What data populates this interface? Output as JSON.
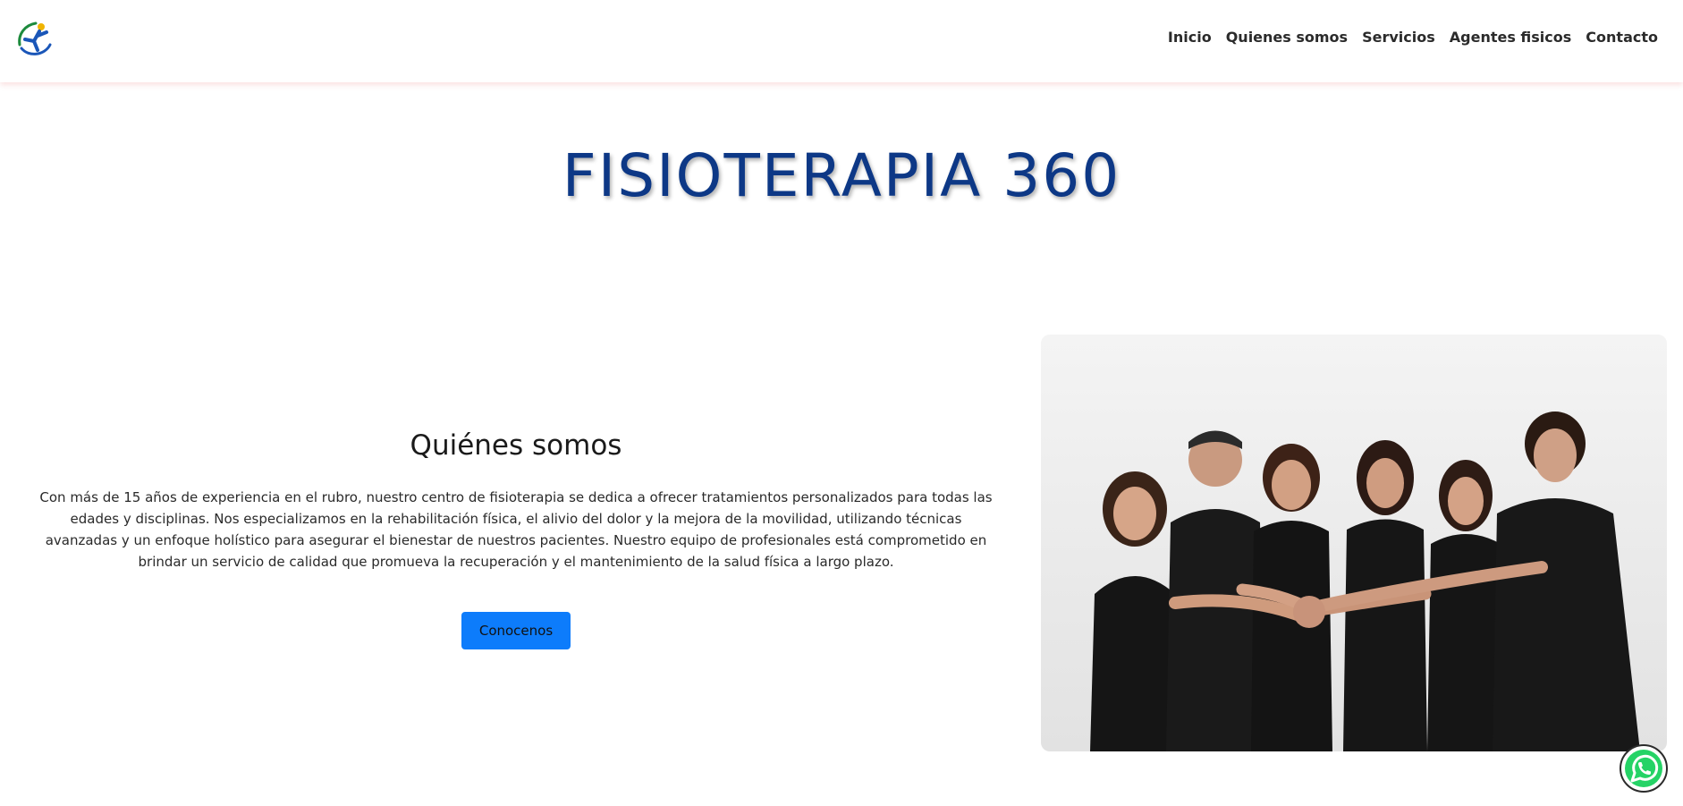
{
  "header": {
    "logo_icon": "physio-runner-logo-icon",
    "nav": [
      {
        "label": "Inicio"
      },
      {
        "label": "Quienes somos"
      },
      {
        "label": "Servicios"
      },
      {
        "label": "Agentes fisicos"
      },
      {
        "label": "Contacto"
      }
    ]
  },
  "hero": {
    "title": "FISIOTERAPIA 360"
  },
  "about": {
    "heading": "Quiénes somos",
    "text": "Con más de 15 años de experiencia en el rubro, nuestro centro de fisioterapia se dedica a ofrecer tratamientos personalizados para todas las edades y disciplinas. Nos especializamos en la rehabilitación física, el alivio del dolor y la mejora de la movilidad, utilizando técnicas avanzadas y un enfoque holístico para asegurar el bienestar de nuestros pacientes. Nuestro equipo de profesionales está comprometido en brindar un servicio de calidad que promueva la recuperación y el mantenimiento de la salud física a largo plazo.",
    "button_label": "Conocenos"
  },
  "photo": {
    "icon": "team-photo"
  },
  "floating": {
    "icon": "whatsapp-icon"
  },
  "colors": {
    "title": "#0d3886",
    "button": "#0d7cfb",
    "whatsapp": "#25d366"
  }
}
